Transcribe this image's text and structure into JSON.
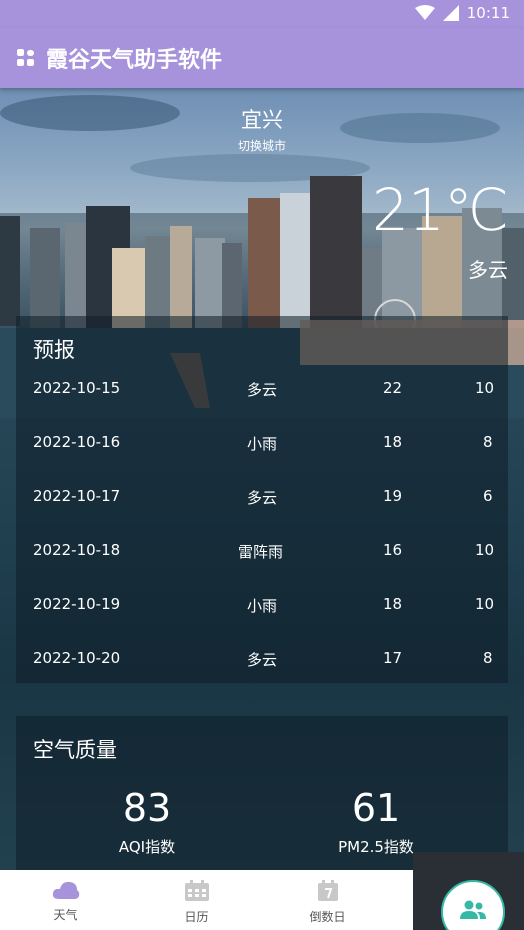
{
  "status": {
    "time": "10:11"
  },
  "appbar": {
    "title": "霞谷天气助手软件"
  },
  "weather": {
    "city": "宜兴",
    "switch_label": "切换城市",
    "temperature": "21℃",
    "condition": "多云"
  },
  "forecast": {
    "title": "预报",
    "rows": [
      {
        "date": "2022-10-15",
        "weather": "多云",
        "high": "22",
        "low": "10"
      },
      {
        "date": "2022-10-16",
        "weather": "小雨",
        "high": "18",
        "low": "8"
      },
      {
        "date": "2022-10-17",
        "weather": "多云",
        "high": "19",
        "low": "6"
      },
      {
        "date": "2022-10-18",
        "weather": "雷阵雨",
        "high": "16",
        "low": "10"
      },
      {
        "date": "2022-10-19",
        "weather": "小雨",
        "high": "18",
        "low": "10"
      },
      {
        "date": "2022-10-20",
        "weather": "多云",
        "high": "17",
        "low": "8"
      }
    ]
  },
  "air": {
    "title": "空气质量",
    "aqi_value": "83",
    "aqi_label": "AQI指数",
    "pm25_value": "61",
    "pm25_label": "PM2.5指数"
  },
  "nav": {
    "items": [
      {
        "label": "天气",
        "icon": "cloud-icon"
      },
      {
        "label": "日历",
        "icon": "calendar-icon"
      },
      {
        "label": "倒数日",
        "icon": "countdown-icon"
      }
    ],
    "fab_icon": "people-icon"
  },
  "colors": {
    "primary": "#a693dc",
    "accent": "#35b8a4",
    "bottom_dark": "#2a2f35"
  }
}
